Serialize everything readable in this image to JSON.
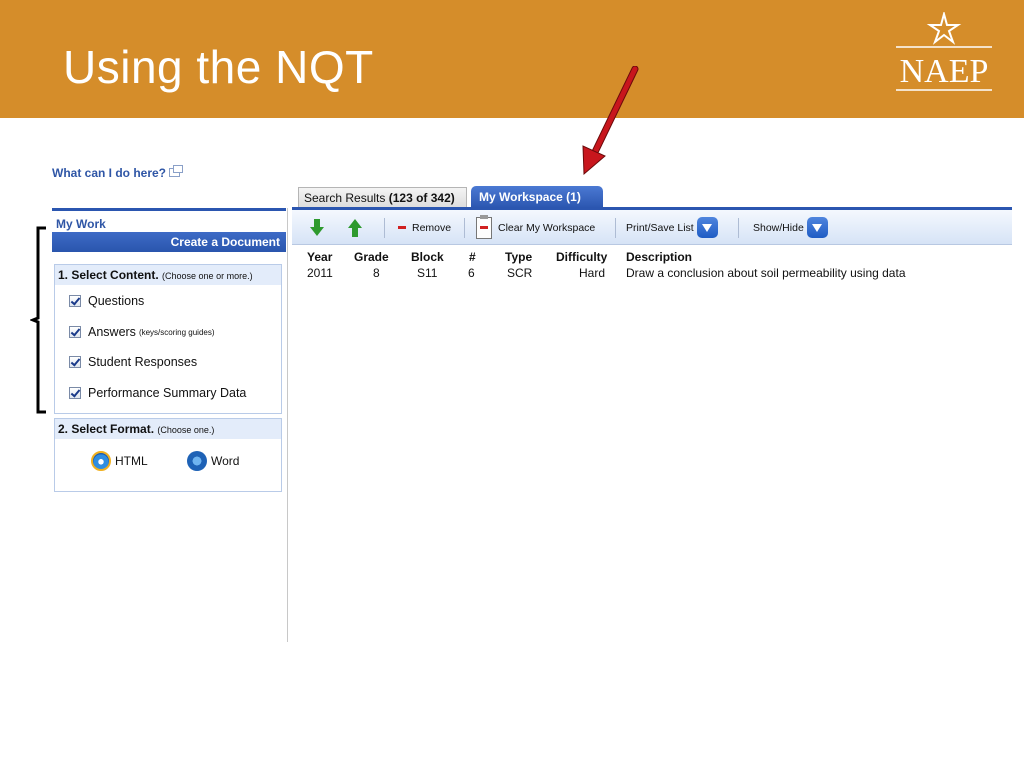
{
  "slide": {
    "title": "Using the NQT",
    "logo_text": "NAEP"
  },
  "help": {
    "link": "What can I do here?"
  },
  "left_panel": {
    "my_work": "My Work",
    "create_document": "Create a Document",
    "content_section": {
      "title": "1. Select Content.",
      "subtitle": "(Choose one or more.)",
      "items": [
        {
          "label": "Questions",
          "sub": "",
          "checked": true
        },
        {
          "label": "Answers",
          "sub": "(keys/scoring guides)",
          "checked": true
        },
        {
          "label": "Student Responses",
          "sub": "",
          "checked": true
        },
        {
          "label": "Performance Summary Data",
          "sub": "",
          "checked": true
        }
      ]
    },
    "format_section": {
      "title": "2. Select Format.",
      "subtitle": "(Choose one.)",
      "options": [
        "HTML",
        "Word"
      ]
    }
  },
  "tabs": {
    "search_label": "Search Results",
    "search_count": "(123 of 342)",
    "workspace": "My Workspace (1)"
  },
  "toolbar": {
    "remove": "Remove",
    "clear": "Clear My Workspace",
    "print": "Print/Save List",
    "show_hide": "Show/Hide"
  },
  "table": {
    "columns": [
      "Year",
      "Grade",
      "Block",
      "#",
      "Type",
      "Difficulty",
      "Description"
    ],
    "rows": [
      [
        "2011",
        "8",
        "S11",
        "6",
        "SCR",
        "Hard",
        "Draw a conclusion about soil permeability using data"
      ]
    ]
  },
  "colors": {
    "header": "#d58d2a",
    "accent": "#2b56b0",
    "arrow": "#c8161d"
  }
}
